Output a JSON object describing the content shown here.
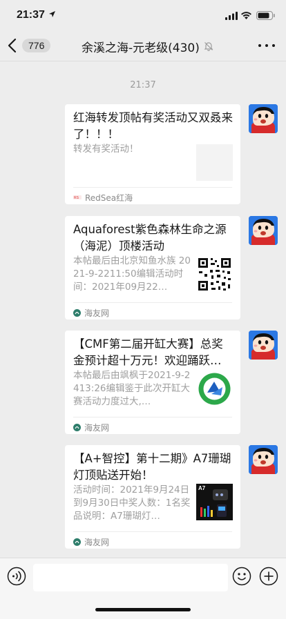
{
  "status_bar": {
    "time": "21:37"
  },
  "nav": {
    "unread_count": "776",
    "title": "余溪之海-元老级(430)"
  },
  "chat": {
    "timestamp": "21:37",
    "messages": [
      {
        "title": "红海转发顶帖有奖活动又双叒来了！！！",
        "description": "转发有奖活动！",
        "source": "RedSea红海"
      },
      {
        "title": "Aquaforest紫色森林生命之源（海泥）顶楼活动",
        "description": "本帖最后由北京知鱼水族 2021-9-2211:50编辑活动时间：2021年09月22…",
        "source": "海友网"
      },
      {
        "title": "【CMF第二届开缸大赛】总奖金预计超十万元！欢迎踊跃…",
        "description": "本帖最后由飒枫于2021-9-2413:26编辑鉴于此次开缸大赛活动力度过大,…",
        "source": "海友网"
      },
      {
        "title": "【A+智控】第十二期》A7珊瑚灯顶贴送开始！",
        "description": "活动时间：2021年9月24日到9月30日中奖人数：1名奖品说明：A7珊瑚灯…",
        "source": "海友网",
        "thumb_label": "A7"
      }
    ]
  },
  "input": {
    "placeholder": ""
  },
  "colors": {
    "background": "#ededed",
    "card": "#ffffff",
    "muted_text": "#9e9e9e",
    "source_icon": "#2e7d6b"
  }
}
